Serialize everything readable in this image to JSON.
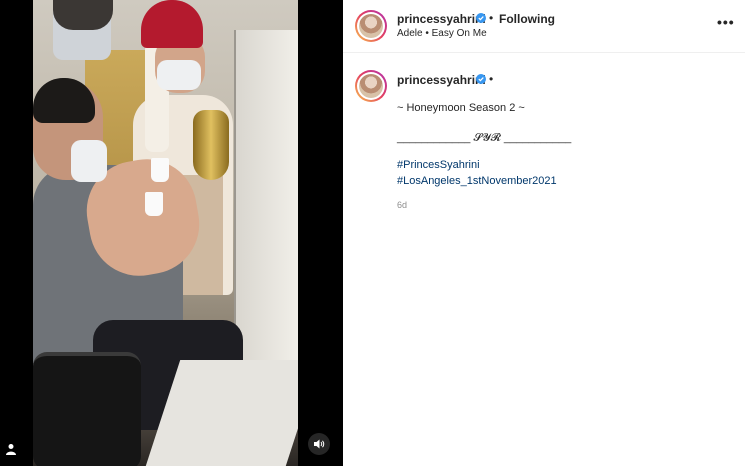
{
  "post": {
    "username": "princessyahrini",
    "separator": "•",
    "follow_status": "Following",
    "song": "Adele • Easy On Me",
    "more_label": "•••",
    "caption_lines": [
      "~ Honeymoon Season 2 ~",
      "____________ 𝓢𝓨𝓡 ___________"
    ],
    "hashtags": [
      "#PrincesSyahrini",
      "#LosAngeles_1stNovember2021"
    ],
    "time_ago": "6d"
  },
  "colors": {
    "verified": "#3897f0",
    "hashtag": "#00376b",
    "text": "#262626",
    "muted": "#8e8e8e"
  },
  "icons": {
    "user": "user-icon",
    "mute": "speaker-icon",
    "verified": "verified-badge-icon"
  }
}
